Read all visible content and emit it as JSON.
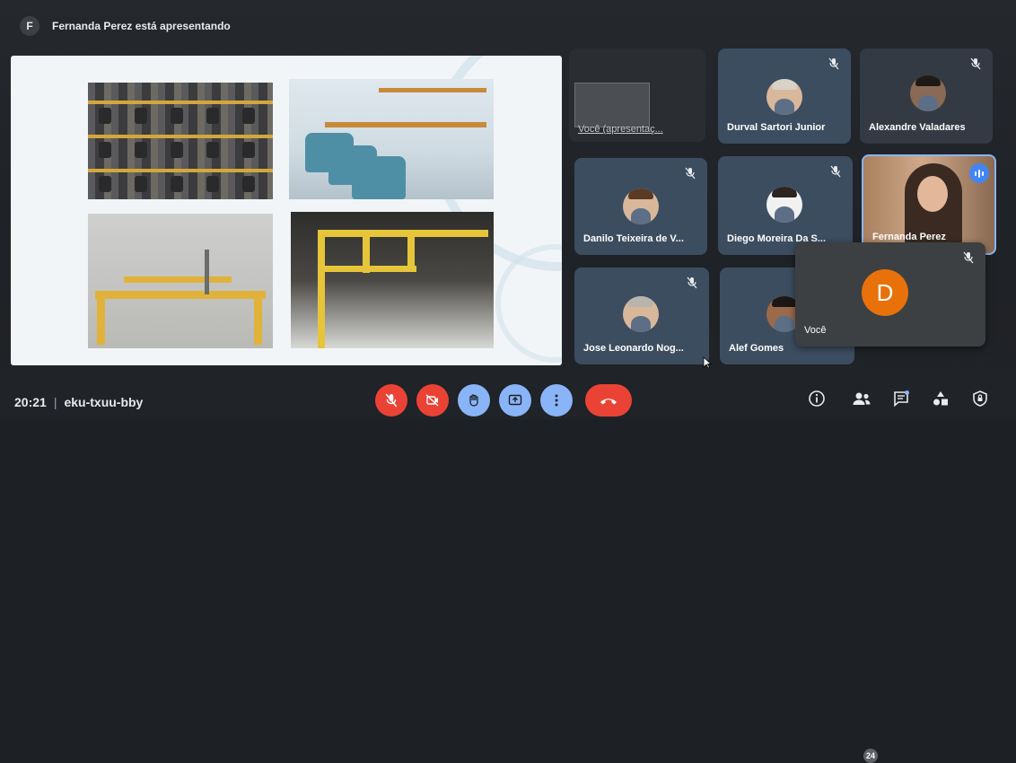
{
  "presenter_bar": {
    "avatar_letter": "F",
    "text": "Fernanda Perez está apresentando"
  },
  "participants": [
    {
      "name": "Você (apresentaç...",
      "type": "presentation"
    },
    {
      "name": "Durval Sartori Junior",
      "muted": true
    },
    {
      "name": "Alexandre Valadares",
      "muted": true
    },
    {
      "name": "Danilo Teixeira de V...",
      "muted": true
    },
    {
      "name": "Diego Moreira Da S...",
      "muted": true
    },
    {
      "name": "Fernanda Perez",
      "speaking": true
    },
    {
      "name": "Jose Leonardo Nog...",
      "muted": true
    },
    {
      "name": "Alef Gomes",
      "muted": true
    }
  ],
  "self_view": {
    "name": "Você",
    "avatar_letter": "D",
    "muted": true,
    "avatar_color": "#e8710a"
  },
  "bottom_bar": {
    "time": "20:21",
    "separator": "|",
    "meeting_code": "eku-txuu-bby",
    "people_count": "24"
  },
  "controls": [
    {
      "name": "mic-off-icon",
      "state": "off"
    },
    {
      "name": "camera-off-icon",
      "state": "off"
    },
    {
      "name": "raise-hand-icon"
    },
    {
      "name": "present-screen-icon"
    },
    {
      "name": "more-options-icon"
    },
    {
      "name": "end-call-icon"
    }
  ],
  "right_controls": [
    "info-icon",
    "people-icon",
    "chat-icon",
    "activities-icon",
    "host-controls-icon"
  ],
  "colors": {
    "end_call": "#ea4335",
    "tile": "#3c4d60",
    "self_avatar": "#e8710a",
    "speaking": "#4285f4"
  }
}
